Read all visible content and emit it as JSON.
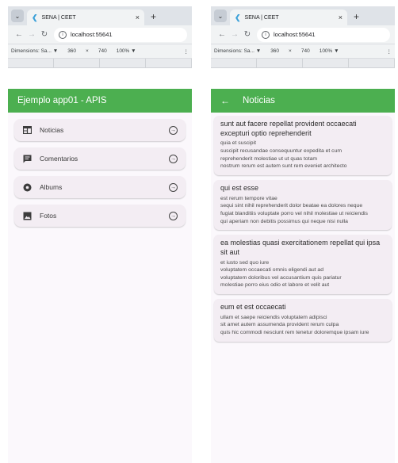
{
  "left_window": {
    "tab": {
      "favicon": "sena-logo-icon",
      "title": "SENA | CEET",
      "close": "×",
      "new_tab": "+"
    },
    "address": {
      "url": "localhost:55641"
    },
    "devtools": {
      "device": "Dimensions: Sa... ▼",
      "width": "360",
      "times": "×",
      "height": "740",
      "zoom": "100% ▼",
      "more": "⋮"
    },
    "app": {
      "title": "Ejemplo app01 - APIS",
      "items": [
        {
          "label": "Noticias",
          "icon": "newspaper-icon"
        },
        {
          "label": "Comentarios",
          "icon": "comment-icon"
        },
        {
          "label": "Albums",
          "icon": "album-icon"
        },
        {
          "label": "Fotos",
          "icon": "photo-icon"
        }
      ]
    }
  },
  "right_window": {
    "tab": {
      "favicon": "sena-logo-icon",
      "title": "SENA | CEET",
      "close": "×",
      "new_tab": "+"
    },
    "address": {
      "url": "localhost:55641"
    },
    "devtools": {
      "device": "Dimensions: Sa... ▼",
      "width": "360",
      "times": "×",
      "height": "740",
      "zoom": "100% ▼",
      "more": "⋮"
    },
    "app": {
      "title": "Noticias",
      "back_icon": "arrow-left-icon",
      "posts": [
        {
          "title": "sunt aut facere repellat provident occaecati excepturi optio reprehenderit",
          "body": "quia et suscipit\nsuscipit recusandae consequuntur expedita et cum\nreprehenderit molestiae ut ut quas totam\nnostrum rerum est autem sunt rem eveniet architecto"
        },
        {
          "title": "qui est esse",
          "body": "est rerum tempore vitae\nsequi sint nihil reprehenderit dolor beatae ea dolores neque\nfugiat blanditiis voluptate porro vel nihil molestiae ut reiciendis\nqui aperiam non debitis possimus qui neque nisi nulla"
        },
        {
          "title": "ea molestias quasi exercitationem repellat qui ipsa sit aut",
          "body": "et iusto sed quo iure\nvoluptatem occaecati omnis eligendi aut ad\nvoluptatem doloribus vel accusantium quis pariatur\nmolestiae porro eius odio et labore et velit aut"
        },
        {
          "title": "eum et est occaecati",
          "body": "ullam et saepe reiciendis voluptatem adipisci\nsit amet autem assumenda provident rerum culpa\nquis hic commodi nesciunt rem tenetur doloremque ipsam iure"
        }
      ]
    }
  },
  "colors": {
    "appbar": "#4caf50",
    "card": "#f3edf3",
    "chrome": "#dfe3e8"
  }
}
